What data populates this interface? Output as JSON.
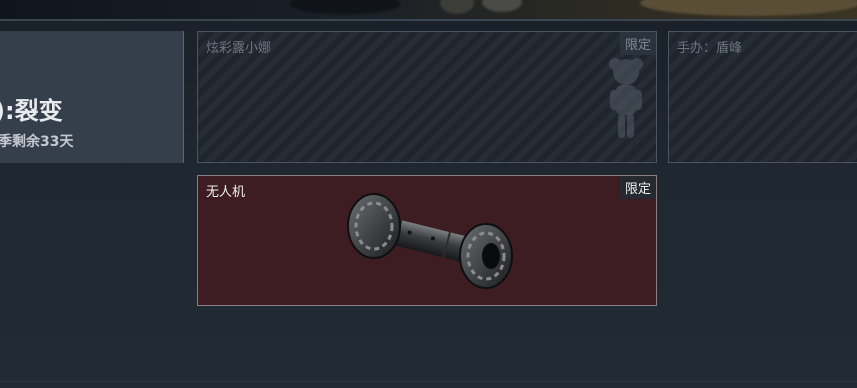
{
  "season": {
    "title": "):裂变",
    "remaining": "季剩余33天"
  },
  "cards": [
    {
      "name": "炫彩露小娜",
      "badge": "限定",
      "state": "locked",
      "icon": "doll-figure-icon"
    },
    {
      "name": "手办：盾峰",
      "badge": "",
      "state": "locked",
      "icon": "figure-icon"
    },
    {
      "name": "无人机",
      "badge": "限定",
      "state": "active",
      "icon": "drone-part-icon"
    }
  ],
  "colors": {
    "active_card_bg": "#3d1d22",
    "locked_card_bg": "#1e252d",
    "season_panel_bg": "#353f4b"
  }
}
